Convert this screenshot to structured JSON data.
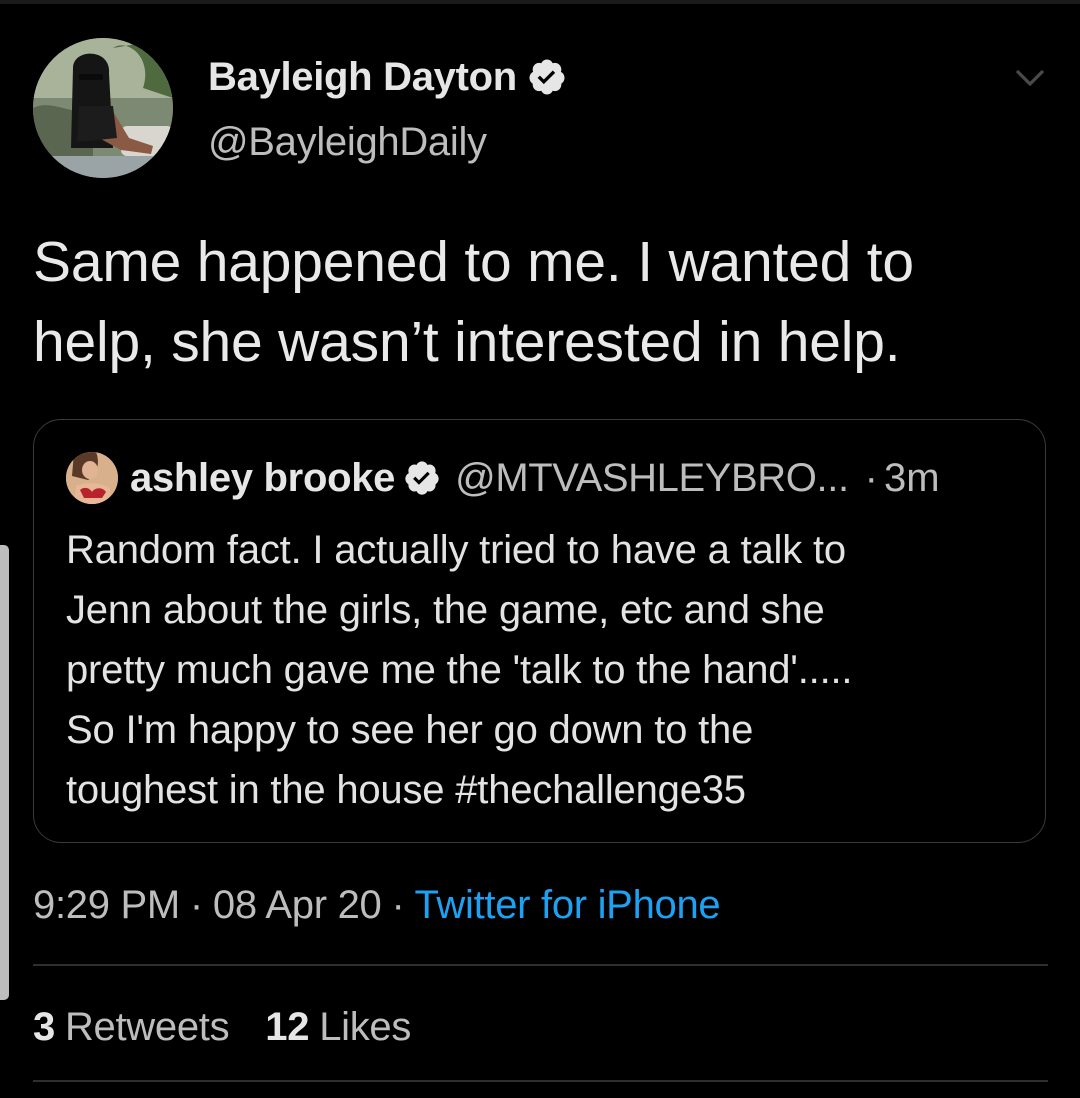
{
  "tweet": {
    "author": {
      "name": "Bayleigh Dayton",
      "handle": "@BayleighDaily",
      "verified": true
    },
    "text": "Same happened to me. I wanted to help, she wasn’t interested in help.",
    "quoted": {
      "name": "ashley brooke",
      "handle": "@MTVASHLEYBRO...",
      "separator": "·",
      "time": "3m",
      "verified": true,
      "text": "Random fact. I actually tried to have a talk to\nJenn about the girls, the game, etc and she\npretty much gave me the 'talk to the hand'.....\nSo I'm happy to see her go down to the\ntoughest in the house  #thechallenge35"
    },
    "meta": {
      "time": "9:29 PM",
      "dot": "·",
      "date": "08 Apr 20",
      "source": "Twitter for iPhone"
    },
    "stats": {
      "retweets_count": "3",
      "retweets_label": "Retweets",
      "likes_count": "12",
      "likes_label": "Likes"
    }
  },
  "colors": {
    "background": "#000000",
    "text_primary": "#e6e6e6",
    "text_secondary": "#bdbdbd",
    "link_blue": "#1da1f2",
    "border": "#3a3a3a"
  },
  "icons": {
    "verified": "verified-badge-icon",
    "more": "chevron-down-icon"
  }
}
